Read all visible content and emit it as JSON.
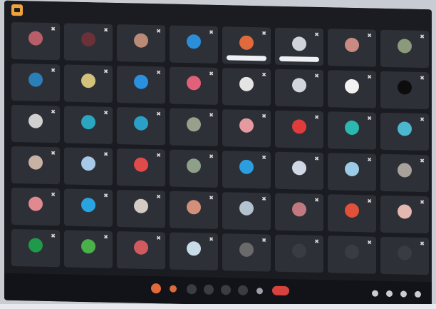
{
  "colors": {
    "window_bg": "#1b1c22",
    "tile_bg": "#2e3037",
    "leave_button": "#d8423e",
    "reaction_button": "#e26a3a",
    "app_badge": "#f0a23c"
  },
  "window": {
    "app_badge_icon": "video-app-icon"
  },
  "gallery": {
    "rows": 6,
    "columns": 8,
    "tiles": [
      {
        "avatar_color": "#b85e68",
        "name": ""
      },
      {
        "avatar_color": "#6a3138",
        "name": ""
      },
      {
        "avatar_color": "#b98b76",
        "name": ""
      },
      {
        "avatar_color": "#2a8fd8",
        "name": ""
      },
      {
        "avatar_color": "#e06a3c",
        "name": "",
        "name_pill": true
      },
      {
        "avatar_color": "#cfd4da",
        "name": "",
        "name_pill": true
      },
      {
        "avatar_color": "#c98a82",
        "name": ""
      },
      {
        "avatar_color": "#8a9a7a",
        "name": ""
      },
      {
        "avatar_color": "#2a7fb8",
        "name": ""
      },
      {
        "avatar_color": "#d4c27a",
        "name": ""
      },
      {
        "avatar_color": "#2a90e0",
        "name": ""
      },
      {
        "avatar_color": "#e1607a",
        "name": ""
      },
      {
        "avatar_color": "#e4e4e4",
        "name": ""
      },
      {
        "avatar_color": "#d2d6da",
        "name": ""
      },
      {
        "avatar_color": "#f2f2f2",
        "name": ""
      },
      {
        "avatar_color": "#0d0d0d",
        "name": ""
      },
      {
        "avatar_color": "#d0d0d0",
        "name": ""
      },
      {
        "avatar_color": "#2aa6c0",
        "name": ""
      },
      {
        "avatar_color": "#2aa0c8",
        "name": ""
      },
      {
        "avatar_color": "#9a9f8c",
        "name": ""
      },
      {
        "avatar_color": "#e49aa0",
        "name": ""
      },
      {
        "avatar_color": "#e03c3c",
        "name": ""
      },
      {
        "avatar_color": "#2ab8b0",
        "name": ""
      },
      {
        "avatar_color": "#4cb8d0",
        "name": ""
      },
      {
        "avatar_color": "#c8b2a4",
        "name": ""
      },
      {
        "avatar_color": "#a8c8e8",
        "name": ""
      },
      {
        "avatar_color": "#e04a4a",
        "name": ""
      },
      {
        "avatar_color": "#8fa08a",
        "name": ""
      },
      {
        "avatar_color": "#2a9ee0",
        "name": ""
      },
      {
        "avatar_color": "#cfd8e4",
        "name": ""
      },
      {
        "avatar_color": "#9ccbe6",
        "name": ""
      },
      {
        "avatar_color": "#a8a29a",
        "name": ""
      },
      {
        "avatar_color": "#e08a90",
        "name": ""
      },
      {
        "avatar_color": "#2aa4e0",
        "name": ""
      },
      {
        "avatar_color": "#d4ccc4",
        "name": ""
      },
      {
        "avatar_color": "#d2907a",
        "name": ""
      },
      {
        "avatar_color": "#b4c2d0",
        "name": ""
      },
      {
        "avatar_color": "#c2787e",
        "name": ""
      },
      {
        "avatar_color": "#e0503a",
        "name": ""
      },
      {
        "avatar_color": "#e2b8b0",
        "name": ""
      },
      {
        "avatar_color": "#1e9a4a",
        "name": ""
      },
      {
        "avatar_color": "#4ab04a",
        "name": ""
      },
      {
        "avatar_color": "#d05a5e",
        "name": ""
      },
      {
        "avatar_color": "#c8dce8",
        "name": ""
      },
      {
        "avatar_color": "#6a6a6a",
        "name": ""
      },
      {
        "avatar_color": "#3a3c44",
        "name": ""
      },
      {
        "avatar_color": "#3a3c44",
        "name": ""
      },
      {
        "avatar_color": "#3a3c44",
        "name": ""
      }
    ]
  },
  "toolbar": {
    "meeting_info": "",
    "controls": [
      {
        "icon": "reaction-icon",
        "style": "react"
      },
      {
        "icon": "raise-hand-icon",
        "style": "raise"
      },
      {
        "icon": "camera-icon",
        "style": ""
      },
      {
        "icon": "microphone-icon",
        "style": ""
      },
      {
        "icon": "screen-share-icon",
        "style": ""
      },
      {
        "icon": "chat-icon",
        "style": ""
      },
      {
        "icon": "participants-icon",
        "style": "small"
      },
      {
        "icon": "leave-call-icon",
        "style": "leave"
      }
    ],
    "right_controls": [
      {
        "icon": "info-icon"
      },
      {
        "icon": "people-icon"
      },
      {
        "icon": "chat-bubble-icon"
      },
      {
        "icon": "activities-icon"
      }
    ]
  }
}
